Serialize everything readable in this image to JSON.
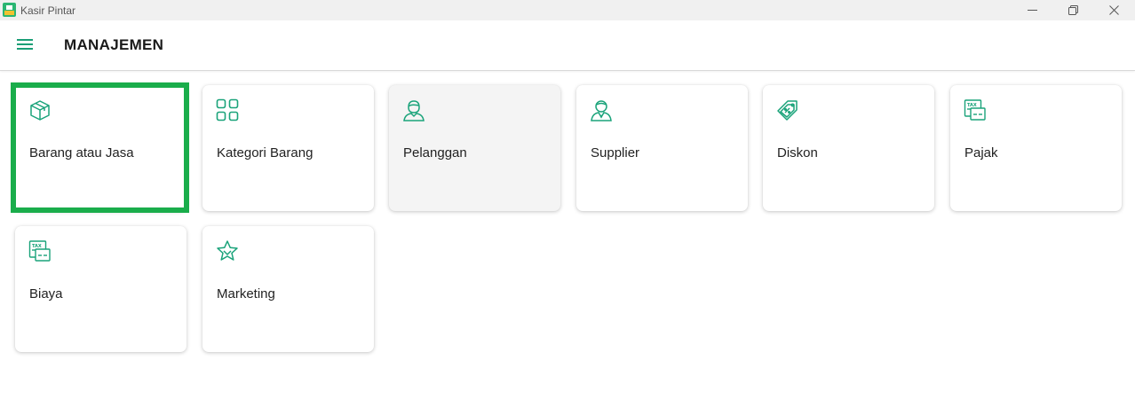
{
  "window": {
    "title": "Kasir Pintar"
  },
  "header": {
    "title": "MANAJEMEN"
  },
  "colors": {
    "accent": "#1aa37a",
    "focus": "#1aad4b",
    "card_hover": "#f4f4f4"
  },
  "cards": [
    {
      "label": "Barang atau Jasa",
      "icon": "box-icon"
    },
    {
      "label": "Kategori Barang",
      "icon": "grid-icon"
    },
    {
      "label": "Pelanggan",
      "icon": "customer-icon"
    },
    {
      "label": "Supplier",
      "icon": "supplier-icon"
    },
    {
      "label": "Diskon",
      "icon": "discount-tag-icon"
    },
    {
      "label": "Pajak",
      "icon": "tax-icon"
    },
    {
      "label": "Biaya",
      "icon": "expense-icon"
    },
    {
      "label": "Marketing",
      "icon": "star-icon"
    }
  ]
}
